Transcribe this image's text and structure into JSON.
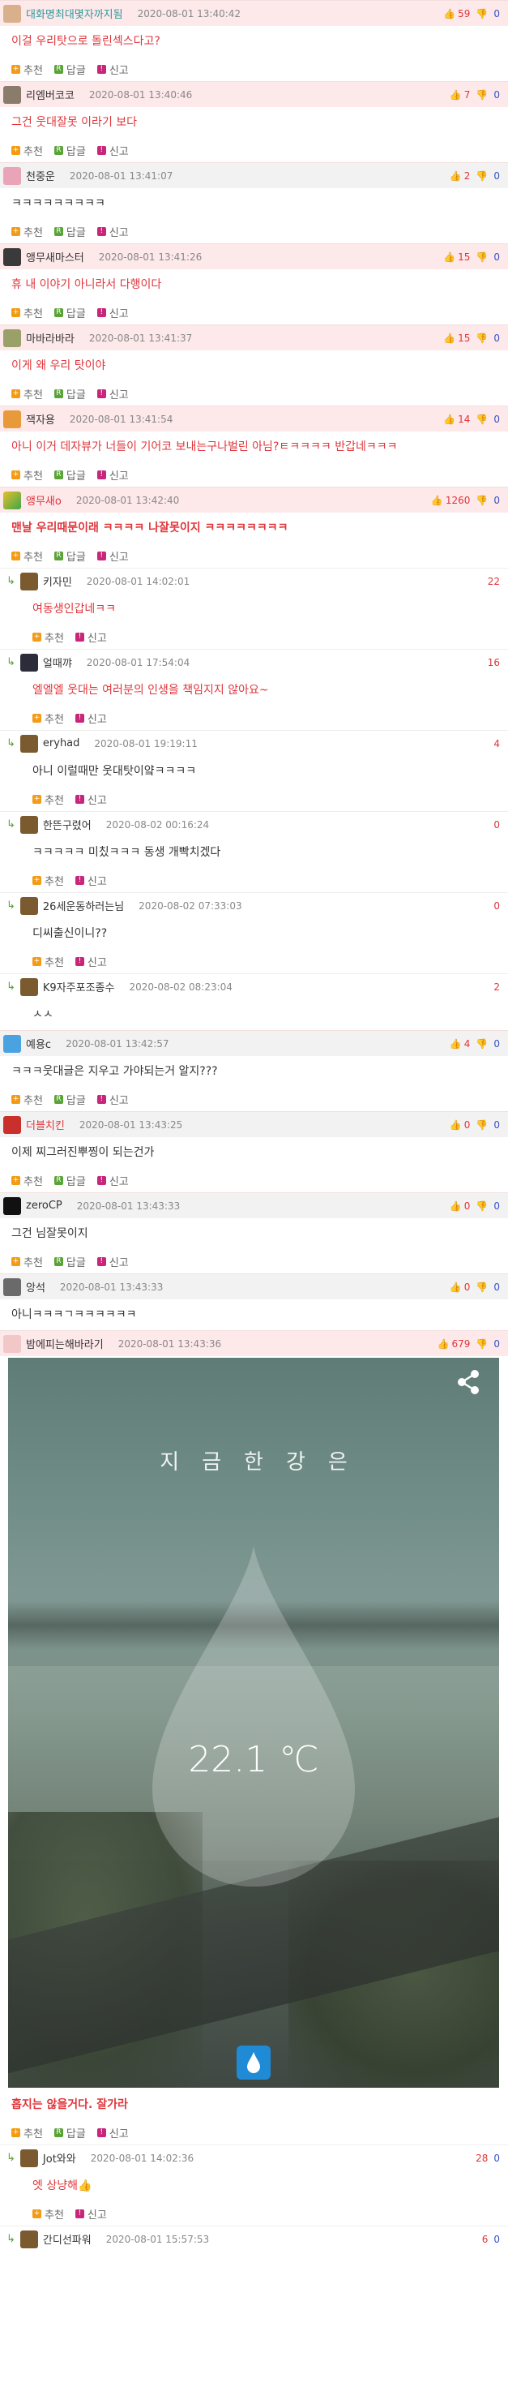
{
  "actions": {
    "recommend": "추천",
    "reply": "답글",
    "report": "신고"
  },
  "comments": [
    {
      "nick": "대화명최대몇자까지됨",
      "date": "2020-08-01 13:40:42",
      "up": "59",
      "down": "0",
      "body": "이걸 우리탓으로 돌린섹스다고?",
      "style": "pink"
    },
    {
      "nick": "리엠버코코",
      "date": "2020-08-01 13:40:46",
      "up": "7",
      "down": "0",
      "body": "그건 웃대잘못 이라기 보다",
      "style": "gray"
    },
    {
      "nick": "천중운",
      "date": "2020-08-01 13:41:07",
      "up": "2",
      "down": "0",
      "body": "ㅋㅋㅋㅋㅋㅋㅋㅋㅋ",
      "style": "gray"
    },
    {
      "nick": "앵무새마스터",
      "date": "2020-08-01 13:41:26",
      "up": "15",
      "down": "0",
      "body": "휴 내 이야기 아니라서 다행이다",
      "style": "pink"
    },
    {
      "nick": "마바라바라",
      "date": "2020-08-01 13:41:37",
      "up": "15",
      "down": "0",
      "body": "이게 왜 우리 탓이야",
      "style": "pink"
    },
    {
      "nick": "잭자용",
      "date": "2020-08-01 13:41:54",
      "up": "14",
      "down": "0",
      "body": "아니 이거 데자뷰가 너들이 기어코 보내는구나벌린 아님?ㅌㅋㅋㅋㅋ 반갑네ㅋㅋㅋ",
      "style": "pink"
    },
    {
      "nick": "앵무새o",
      "date": "2020-08-01 13:42:40",
      "up": "1260",
      "down": "0",
      "body": "맨날 우리때문이래 ㅋㅋㅋㅋ 나잘못이지 ㅋㅋㅋㅋㅋㅋㅋㅋ",
      "style": "pinkbest"
    }
  ],
  "replies": [
    {
      "nick": "키자민",
      "date": "2020-08-01 14:02:01",
      "up": "22",
      "down": "",
      "body": "여동생인갑네ㅋㅋ"
    },
    {
      "nick": "얼때꺄",
      "date": "2020-08-01 17:54:04",
      "up": "16",
      "down": "",
      "body": "엘엘엘 웃대는 여러분의 인생을 책임지지 않아요~"
    },
    {
      "nick": "eryhad",
      "date": "2020-08-01 19:19:11",
      "up": "4",
      "down": "",
      "body": "아니 이럴때만 웃대탓이얔ㅋㅋㅋㅋ"
    },
    {
      "nick": "한뜬구렸어",
      "date": "2020-08-02 00:16:24",
      "up": "0",
      "down": "",
      "body": "ㅋㅋㅋㅋㅋ 미칬ㅋㅋㅋ 동생 개빡치겠다"
    },
    {
      "nick": "26세운동하러는님",
      "date": "2020-08-02 07:33:03",
      "up": "0",
      "down": "",
      "body": "디씨출신이니??"
    },
    {
      "nick": "K9자주포조종수",
      "date": "2020-08-02 08:23:04",
      "up": "2",
      "down": "",
      "body": "ㅅㅅ"
    }
  ],
  "comments2": [
    {
      "nick": "예용c",
      "date": "2020-08-01 13:42:57",
      "up": "4",
      "down": "0",
      "body": "ㅋㅋㅋ웃대글은 지우고 가야되는거 알지???",
      "style": "gray"
    },
    {
      "nick": "더블치킨",
      "date": "2020-08-01 13:43:25",
      "up": "0",
      "down": "0",
      "body": "이제 찌그러진뿌찡이 되는건가",
      "style": "gray"
    },
    {
      "nick": "zeroCP",
      "date": "2020-08-01 13:43:33",
      "up": "0",
      "down": "0",
      "body": "그건 님잘못이지",
      "style": "gray"
    },
    {
      "nick": "앙석",
      "date": "2020-08-01 13:43:33",
      "up": "0",
      "down": "0",
      "body": "아니ㅋㅋㅋㄱㅋㅋㅋㅋㅋㅋ",
      "style": "gray"
    }
  ],
  "best2": {
    "nick": "밤에피는해바라기",
    "date": "2020-08-01 13:43:36",
    "up": "679",
    "down": "0",
    "body": "흡지는 않을거다. 잘가라"
  },
  "image": {
    "title": "지금한강은",
    "temp": "22.1 ℃"
  },
  "replies2": [
    {
      "nick": "Jot와와",
      "date": "2020-08-01 14:02:36",
      "up": "28",
      "down": "0",
      "body": "엣 상냥해👍"
    },
    {
      "nick": "간디선파워",
      "date": "2020-08-01 15:57:53",
      "up": "6",
      "down": "0",
      "body": ""
    }
  ],
  "colors": {
    "accent_red": "#e0353b",
    "down_blue": "#3a52c8",
    "pink_bg": "#fde8ea",
    "gray_bg": "#f2f2f2",
    "rec": "#f39b15",
    "rep": "#5aa336",
    "rpt": "#c8267b"
  }
}
